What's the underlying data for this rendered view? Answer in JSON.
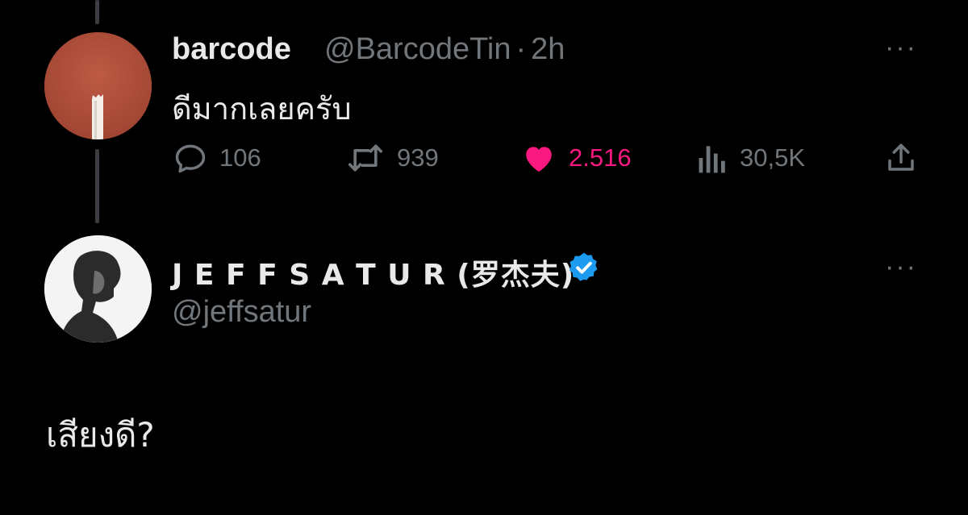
{
  "reply_tweet": {
    "display_name": "barcode",
    "handle": "@BarcodeTin",
    "separator": "·",
    "time": "2h",
    "text": "ดีมากเลยครับ",
    "more_label": "···",
    "actions": {
      "replies": "106",
      "retweets": "939",
      "likes": "2.516",
      "views": "30,5K"
    },
    "like_state": "liked",
    "avatar_icon": "candle-avatar"
  },
  "main_tweet": {
    "display_name": "J E F F S A T U R (罗杰夫)",
    "handle": "@jeffsatur",
    "verified_icon": "verified-badge-icon",
    "more_label": "···",
    "text": "เสียงดี?",
    "avatar_icon": "portrait-avatar"
  },
  "colors": {
    "background": "#000000",
    "primary_text": "#e7e9ea",
    "secondary_text": "#71767b",
    "like": "#f91880",
    "verified": "#1d9bf0",
    "thread_line": "#3a3d41"
  }
}
